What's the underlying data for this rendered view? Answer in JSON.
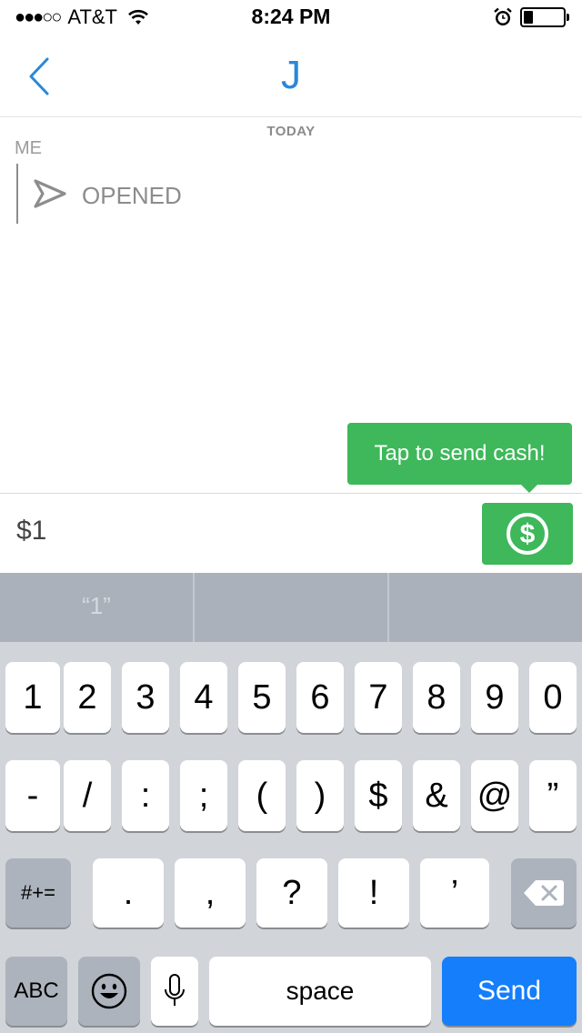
{
  "status_bar": {
    "carrier": "AT&T",
    "signal_dots": "●●●○○",
    "time": "8:24 PM"
  },
  "header": {
    "title": "J"
  },
  "chat": {
    "date_label": "TODAY",
    "sender_label": "ME",
    "message_status": "OPENED"
  },
  "tooltip": {
    "text": "Tap to send cash!"
  },
  "compose": {
    "amount_value": "$1"
  },
  "keyboard": {
    "suggestions": [
      "“1”",
      "",
      ""
    ],
    "row1": [
      "1",
      "2",
      "3",
      "4",
      "5",
      "6",
      "7",
      "8",
      "9",
      "0"
    ],
    "row2": [
      "-",
      "/",
      ":",
      ";",
      "(",
      ")",
      "$",
      "&",
      "@",
      "”"
    ],
    "row3": {
      "switch_label": "#+=",
      "keys": [
        ".",
        ",",
        "?",
        "!",
        "’"
      ]
    },
    "row4": {
      "abc_label": "ABC",
      "space_label": "space",
      "send_label": "Send"
    }
  },
  "colors": {
    "accent_blue": "#2a88d8",
    "cash_green": "#3eb85a",
    "send_blue": "#147efb"
  }
}
